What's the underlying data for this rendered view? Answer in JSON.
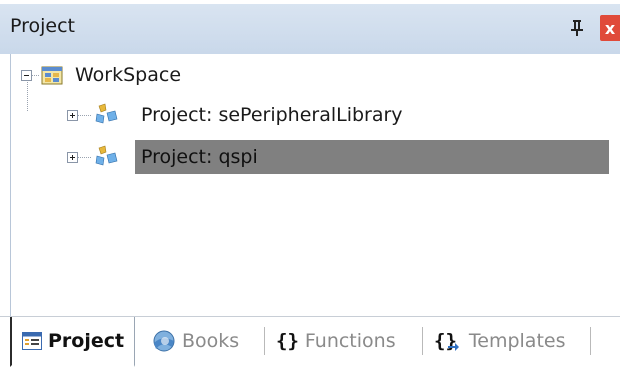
{
  "panel": {
    "title": "Project",
    "pin_glyph": "†",
    "close_glyph": "x"
  },
  "tree": {
    "root": {
      "label": "WorkSpace",
      "icon": "workspace-icon",
      "expanded": true
    },
    "children": [
      {
        "label": "Project: sePeripheralLibrary",
        "icon": "project-icon",
        "expanded": false,
        "selected": false
      },
      {
        "label": "Project: qspi",
        "icon": "project-icon",
        "expanded": false,
        "selected": true
      }
    ]
  },
  "tabs": [
    {
      "label": "Project",
      "icon": "project-tab-icon",
      "active": true
    },
    {
      "label": "Books",
      "icon": "books-icon",
      "active": false
    },
    {
      "label": "Functions",
      "icon": "braces-icon",
      "glyph": "{}",
      "active": false
    },
    {
      "label": "Templates",
      "icon": "templates-icon",
      "glyph": "{}",
      "active": false
    }
  ],
  "colors": {
    "title_bar": "#d3dfee",
    "close_button": "#e04a3a",
    "selection": "#808080"
  }
}
